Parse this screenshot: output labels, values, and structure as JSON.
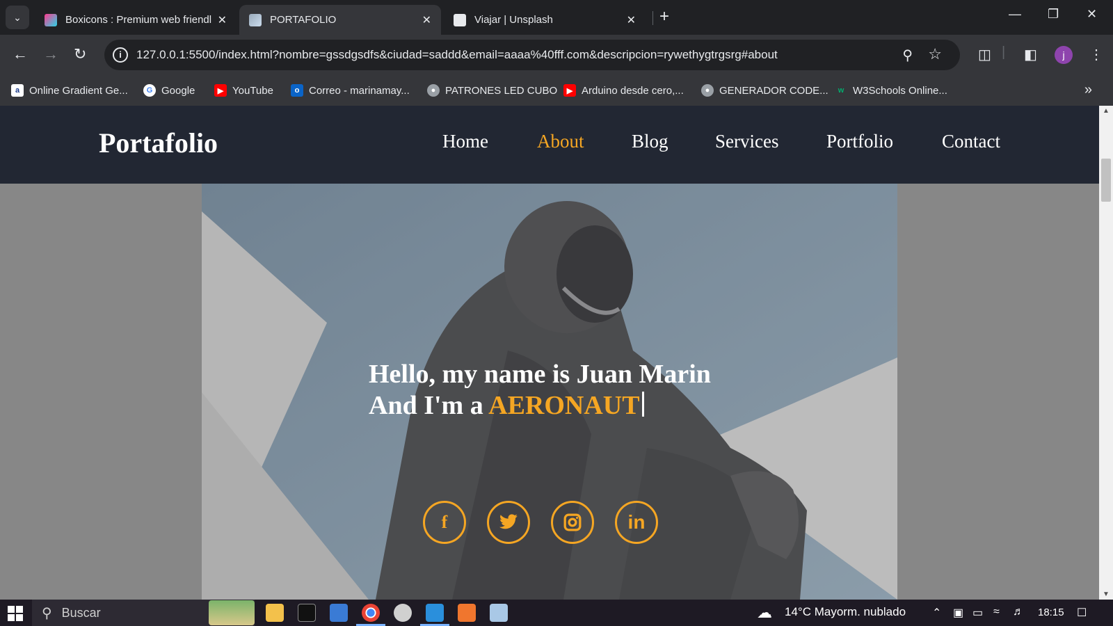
{
  "browser": {
    "tabs": [
      {
        "title": "Boxicons : Premium web friendl",
        "active": false
      },
      {
        "title": "PORTAFOLIO",
        "active": true
      },
      {
        "title": "Viajar | Unsplash",
        "active": false
      }
    ],
    "url": "127.0.0.1:5500/index.html?nombre=gssdgsdfs&ciudad=saddd&email=aaaa%40fff.com&descripcion=rywethygtrgsrg#about",
    "profile_initial": "j",
    "bookmarks": [
      "Online Gradient Ge...",
      "Google",
      "YouTube",
      "Correo - marinamay...",
      "PATRONES LED CUBO",
      "Arduino desde cero,...",
      "GENERADOR CODE...",
      "W3Schools Online..."
    ]
  },
  "site": {
    "logo": "Portafolio",
    "nav": [
      {
        "label": "Home",
        "active": false
      },
      {
        "label": "About",
        "active": true
      },
      {
        "label": "Blog",
        "active": false
      },
      {
        "label": "Services",
        "active": false
      },
      {
        "label": "Portfolio",
        "active": false
      },
      {
        "label": "Contact",
        "active": false
      }
    ],
    "hero": {
      "line1": "Hello, my name is Juan Marin",
      "line2_prefix": "And I'm a ",
      "role": "AERONAUT"
    },
    "social": [
      "facebook-icon",
      "twitter-icon",
      "instagram-icon",
      "linkedin-icon"
    ],
    "accent_color": "#f5a623",
    "header_color": "#222733"
  },
  "taskbar": {
    "search_placeholder": "Buscar",
    "weather": "14°C  Mayorm. nublado",
    "time": "18:15"
  }
}
